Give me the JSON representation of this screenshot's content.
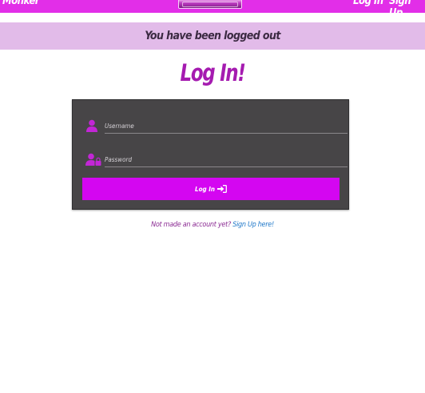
{
  "header": {
    "brand": "Monker",
    "nav_login": "Log In",
    "nav_signup": "Sign Up"
  },
  "alert": {
    "message": "You have been logged out"
  },
  "login": {
    "title": "Log In!",
    "username_placeholder": "Username",
    "password_placeholder": "Password",
    "button_label": "Log In"
  },
  "footer": {
    "prompt": "Not made an account yet?",
    "signup_link": "Sign Up here!"
  },
  "colors": {
    "nav_bg": "#e22ee8",
    "alert_bg": "#e2bbe9",
    "title": "#a51bb0",
    "panel_bg": "#474547",
    "button_bg": "#d406f1",
    "icon": "#c226d6",
    "link": "#1f78c9"
  },
  "icons": [
    "user-icon",
    "user-lock-icon",
    "sign-in-icon"
  ]
}
